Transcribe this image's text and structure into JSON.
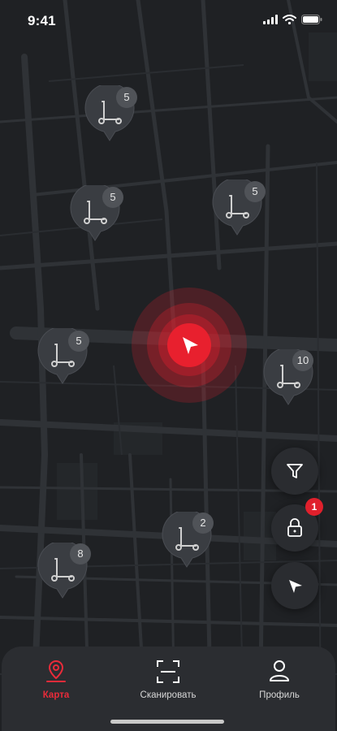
{
  "status_bar": {
    "time": "9:41",
    "icons": [
      "signal-icon",
      "wifi-icon",
      "battery-icon"
    ]
  },
  "map": {
    "scooter_pins": [
      {
        "count": "5"
      },
      {
        "count": "5"
      },
      {
        "count": "5"
      },
      {
        "count": "5"
      },
      {
        "count": "10"
      },
      {
        "count": "2"
      },
      {
        "count": "8"
      }
    ]
  },
  "controls": {
    "filter": {
      "icon": "filter-icon"
    },
    "lock": {
      "icon": "lock-icon",
      "badge": "1"
    },
    "locate": {
      "icon": "navigation-arrow-icon"
    }
  },
  "tab_bar": {
    "tabs": [
      {
        "label": "Карта",
        "icon": "map-pin-icon",
        "active": true
      },
      {
        "label": "Сканировать",
        "icon": "scan-icon",
        "active": false
      },
      {
        "label": "Профиль",
        "icon": "profile-icon",
        "active": false
      }
    ]
  },
  "colors": {
    "accent": "#e8202e",
    "background": "#1f2124",
    "pin": "#3a3d42",
    "tab_bar": "#2b2d31"
  }
}
